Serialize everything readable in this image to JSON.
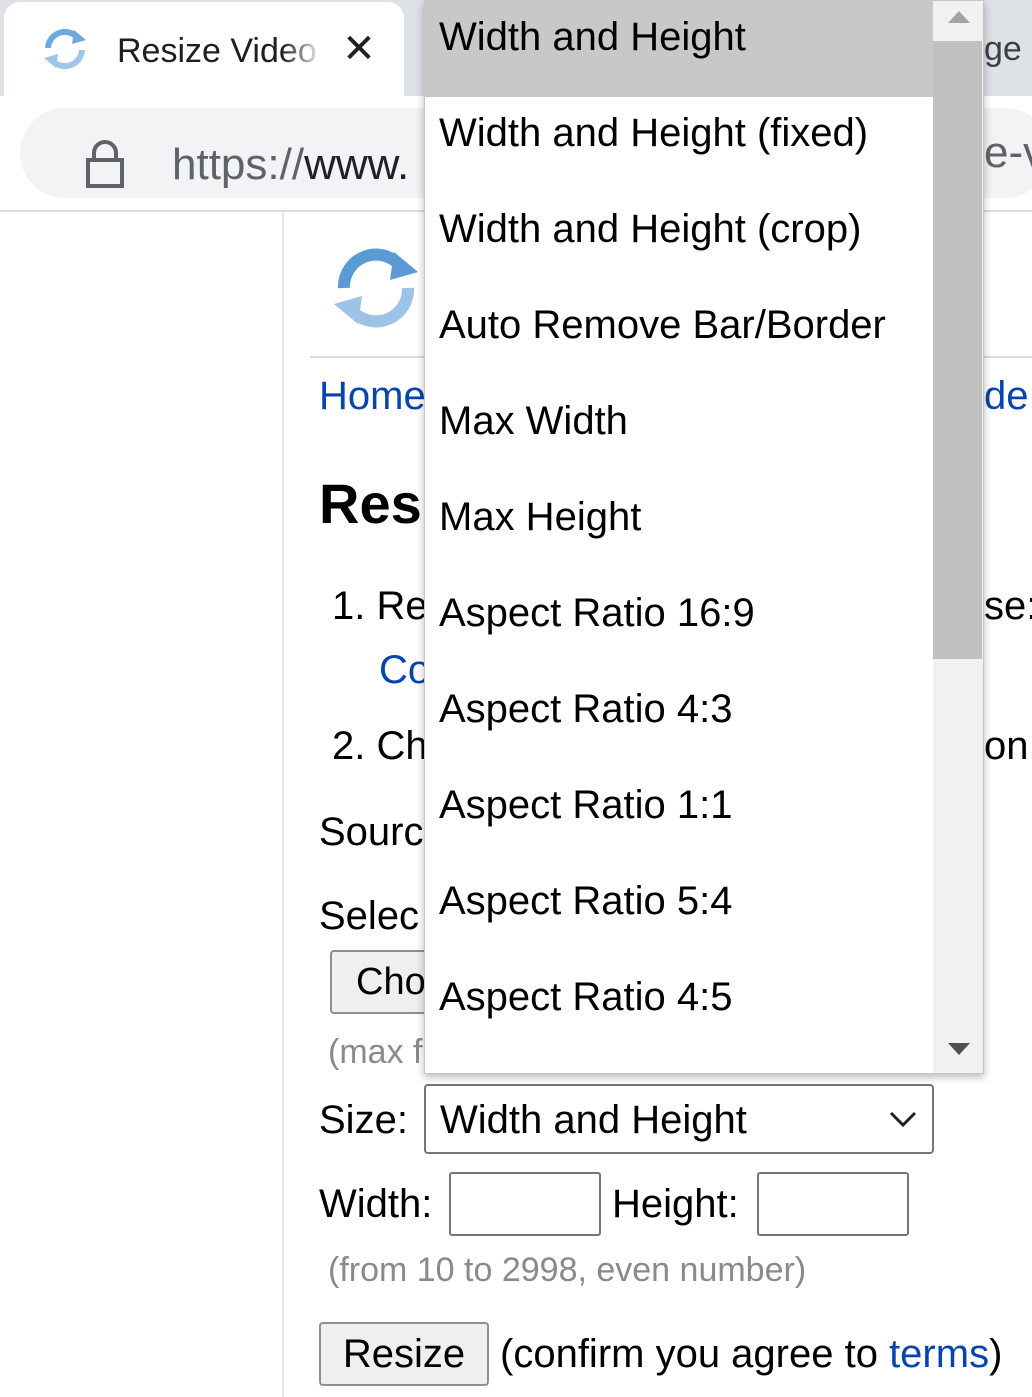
{
  "browser": {
    "tab_active_title": "Resize Video",
    "tab_close_glyph": "✕",
    "tab_second_partial": "ge",
    "url_scheme": "https://",
    "url_host_partial": "www.",
    "url_tail_partial": "e-v"
  },
  "page": {
    "nav_home": "Home",
    "nav_tail": "de",
    "title": "Res",
    "step1": "1. Re",
    "step1_link": "Co",
    "step1_tail": "se:",
    "step2": "2. Ch",
    "step2_tail": "on",
    "source_label": "Sourc",
    "select_label": "Selec",
    "choose_button": "Cho",
    "max_hint": "(max f",
    "size_label": "Size:",
    "size_selected": "Width and Height",
    "width_label": "Width:",
    "width_value": "",
    "height_label": "Height:",
    "height_value": "",
    "range_hint": "(from 10 to 2998, even number)",
    "resize_button": "Resize",
    "confirm_prefix": "(confirm you agree to ",
    "confirm_link": "terms",
    "confirm_suffix": ")"
  },
  "dropdown": {
    "options": [
      "Width and Height",
      "Width and Height (fixed)",
      "Width and Height (crop)",
      "Auto Remove Bar/Border",
      "Max Width",
      "Max Height",
      "Aspect Ratio 16:9",
      "Aspect Ratio 4:3",
      "Aspect Ratio 1:1",
      "Aspect Ratio 5:4",
      "Aspect Ratio 4:5"
    ],
    "selected_index": 0
  },
  "colors": {
    "link": "#0645ad",
    "selected_option": "#c8c8c8",
    "hint_text": "#8a8a8a",
    "tabstrip": "#dee1e6"
  },
  "icons": {
    "favicon": "refresh-arrows-icon",
    "lock": "lock-icon",
    "chevron": "chevron-down-icon",
    "scroll_up": "scroll-up-arrow-icon",
    "scroll_down": "scroll-down-arrow-icon"
  }
}
